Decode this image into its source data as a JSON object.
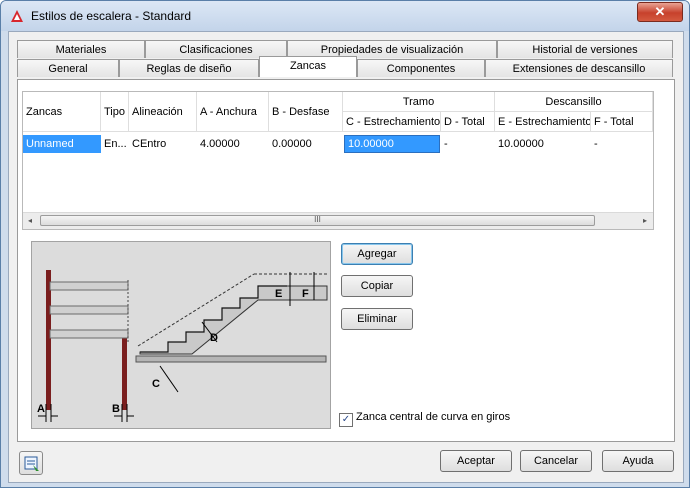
{
  "window": {
    "title": "Estilos de escalera - Standard",
    "close_label": "✕"
  },
  "tabs_back": [
    {
      "label": "Materiales"
    },
    {
      "label": "Clasificaciones"
    },
    {
      "label": "Propiedades de visualización"
    },
    {
      "label": "Historial de versiones"
    }
  ],
  "tabs_front": [
    {
      "label": "General"
    },
    {
      "label": "Reglas de diseño"
    },
    {
      "label": "Zancas",
      "active": true
    },
    {
      "label": "Componentes"
    },
    {
      "label": "Extensiones de descansillo"
    }
  ],
  "grid": {
    "group_headers": {
      "tramo": "Tramo",
      "descansillo": "Descansillo"
    },
    "columns": [
      "Zancas",
      "Tipo",
      "Alineación",
      "A - Anchura",
      "B - Desfase",
      "C - Estrechamiento",
      "D - Total",
      "E - Estrechamiento",
      "F - Total"
    ],
    "rows": [
      {
        "zancas": "Unnamed",
        "tipo": "En...",
        "alineacion": "CEntro",
        "a_anchura": "4.00000",
        "b_desfase": "0.00000",
        "c_estrechamiento": "10.00000",
        "d_total": "-",
        "e_estrechamiento": "10.00000",
        "f_total": "-"
      }
    ],
    "scroll_grip": "III",
    "scroll_left": "◂",
    "scroll_right": "▸"
  },
  "diagram_labels": {
    "a": "A",
    "b": "B",
    "c": "C",
    "d": "D",
    "e": "E",
    "f": "F"
  },
  "buttons": {
    "agregar": "Agregar",
    "copiar": "Copiar",
    "eliminar": "Eliminar"
  },
  "checkbox": {
    "label": "Zanca central de curva en giros",
    "checked": true,
    "mark": "✓"
  },
  "footer": {
    "aceptar": "Aceptar",
    "cancelar": "Cancelar",
    "ayuda": "Ayuda"
  },
  "colors": {
    "accent": "#3399ff",
    "title_bg": "#cfdcec",
    "selection": "#3399ff"
  }
}
